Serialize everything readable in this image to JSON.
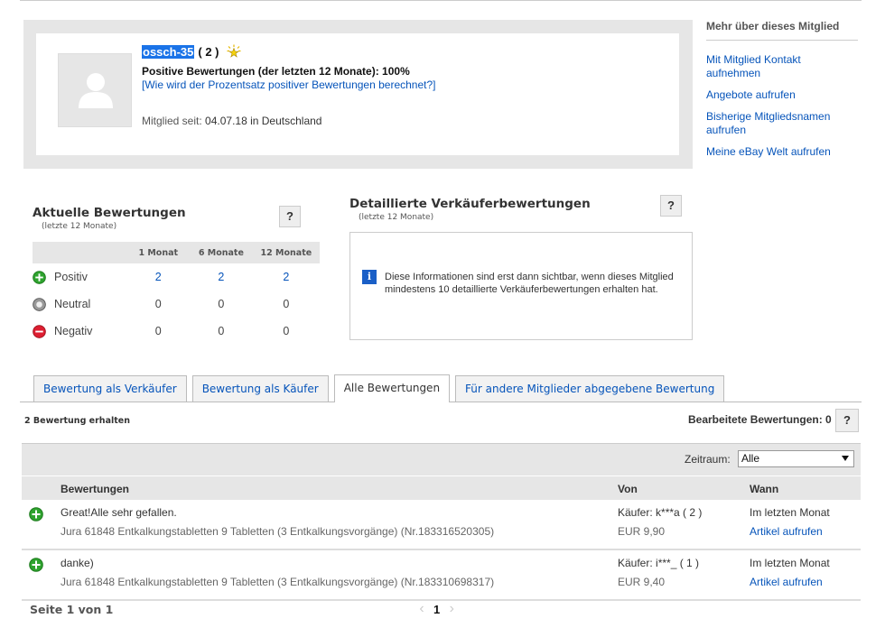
{
  "profile": {
    "username": "ossch-35",
    "score": "( 2 )",
    "positive_line": "Positive Bewertungen (der letzten 12 Monate): 100%",
    "calc_link": "[Wie wird der Prozentsatz positiver Bewertungen berechnet?]",
    "member_since_label": "Mitglied seit:",
    "member_since_value": "04.07.18 in Deutschland"
  },
  "sidebar": {
    "title": "Mehr über dieses Mitglied",
    "links": [
      "Mit Mitglied Kontakt aufnehmen",
      "Angebote aufrufen",
      "Bisherige Mitgliedsnamen aufrufen",
      "Meine eBay Welt aufrufen"
    ]
  },
  "recent": {
    "title": "Aktuelle Bewertungen",
    "subtitle": "(letzte 12 Monate)",
    "help": "?",
    "columns": [
      "1 Monat",
      "6 Monate",
      "12 Monate"
    ],
    "rows": [
      {
        "label": "Positiv",
        "values": [
          "2",
          "2",
          "2"
        ],
        "color": "#2ea32e"
      },
      {
        "label": "Neutral",
        "values": [
          "0",
          "0",
          "0"
        ],
        "color": "#888888"
      },
      {
        "label": "Negativ",
        "values": [
          "0",
          "0",
          "0"
        ],
        "color": "#dd1e31"
      }
    ]
  },
  "dsr": {
    "title": "Detaillierte Verkäuferbewertungen",
    "subtitle": "(letzte 12 Monate)",
    "help": "?",
    "info_icon": "i",
    "info_text": "Diese Informationen sind erst dann sichtbar, wenn dieses Mitglied mindestens 10 detaillierte Verkäuferbewertungen erhalten hat."
  },
  "tabs": [
    "Bewertung als Verkäufer",
    "Bewertung als Käufer",
    "Alle Bewertungen",
    "Für andere Mitglieder abgegebene Bewertung"
  ],
  "active_tab": "Alle Bewertungen",
  "received": "2 Bewertung erhalten",
  "edited": "Bearbeitete Bewertungen: 0",
  "edited_help": "?",
  "filter": {
    "label": "Zeitraum:",
    "selected": "Alle"
  },
  "table": {
    "headers": [
      "Bewertungen",
      "Von",
      "Wann"
    ],
    "rows": [
      {
        "comment": "Great!Alle sehr gefallen.",
        "item": "Jura 61848 Entkalkungstabletten 9 Tabletten (3 Entkalkungsvorgänge) (Nr.183316520305)",
        "buyer": "Käufer: k***a ( 2 )",
        "price": "EUR 9,90",
        "when": "Im letzten Monat",
        "view": "Artikel aufrufen"
      },
      {
        "comment": "danke)",
        "item": "Jura 61848 Entkalkungstabletten 9 Tabletten (3 Entkalkungsvorgänge) (Nr.183310698317)",
        "buyer": "Käufer: i***_ ( 1 )",
        "price": "EUR 9,40",
        "when": "Im letzten Monat",
        "view": "Artikel aufrufen"
      }
    ]
  },
  "pager": {
    "label": "Seite 1 von 1",
    "current": "1"
  }
}
